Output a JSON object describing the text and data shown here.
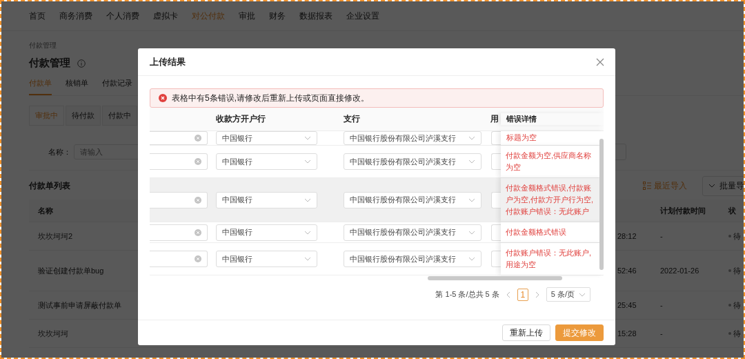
{
  "nav": {
    "items": [
      {
        "label": "首页",
        "selected": false
      },
      {
        "label": "商务消费",
        "selected": false
      },
      {
        "label": "个人消费",
        "selected": false
      },
      {
        "label": "虚拟卡",
        "selected": false
      },
      {
        "label": "对公付款",
        "selected": true
      },
      {
        "label": "审批",
        "selected": false
      },
      {
        "label": "财务",
        "selected": false
      },
      {
        "label": "数据报表",
        "selected": false
      },
      {
        "label": "企业设置",
        "selected": false
      }
    ]
  },
  "breadcrumb": "付款管理",
  "page_title": "付款管理",
  "tabs": [
    {
      "label": "付款单",
      "selected": true
    },
    {
      "label": "核销单",
      "selected": false
    },
    {
      "label": "付款记录",
      "selected": false
    }
  ],
  "status_tabs": [
    {
      "label": "审批中",
      "selected": true
    },
    {
      "label": "待付款",
      "selected": false
    },
    {
      "label": "付款中",
      "selected": false
    }
  ],
  "filter": {
    "label": "名称：",
    "placeholder": "请输入"
  },
  "list": {
    "title": "付款单列表",
    "actions": [
      {
        "label": "最近导入",
        "kind": "link"
      },
      {
        "label": "批量导",
        "kind": "dropdown"
      }
    ],
    "columns": {
      "name": "名称",
      "planned": "计划付款时间",
      "status": "状"
    },
    "rows": [
      {
        "name": "坎坎坷坷2",
        "time": "28:12",
        "planned": "-",
        "status": "待"
      },
      {
        "name": "验证创建付款单bug",
        "time": "52:46",
        "planned": "2022-01-26",
        "status": "待"
      },
      {
        "name": "测试事前申请屏蔽付款单",
        "time": "25:45",
        "planned": "-",
        "status": "待"
      },
      {
        "name": "坎坎坷坷",
        "time": "15:28",
        "planned": "-",
        "status": "待"
      }
    ]
  },
  "modal": {
    "title": "上传结果",
    "alert": "表格中有5条错误,请修改后重新上传或页面直接修改。",
    "table": {
      "columns": [
        "收款方开户行",
        "支行",
        "用"
      ],
      "error_column": "错误详情",
      "rows": [
        {
          "bank": "中国银行",
          "branch": "中国银行股份有限公司泸溪支行",
          "error": "标题为空",
          "highlighted": false
        },
        {
          "bank": "中国银行",
          "branch": "中国银行股份有限公司泸溪支行",
          "error": "付款金额为空,供应商名称为空",
          "highlighted": false
        },
        {
          "bank": "中国银行",
          "branch": "中国银行股份有限公司泸溪支行",
          "error": "付款金额格式错误,付款账户为空,付款方开户行为空,付款账户错误：无此账户",
          "highlighted": true
        },
        {
          "bank": "中国银行",
          "branch": "中国银行股份有限公司泸溪支行",
          "error": "付款金额格式错误",
          "highlighted": false
        },
        {
          "bank": "中国银行",
          "branch": "中国银行股份有限公司泸溪支行",
          "error": "付款账户错误：无此账户,用途为空",
          "highlighted": false
        }
      ]
    },
    "pagination": {
      "summary": "第 1-5 条/总共 5 条",
      "pages": [
        {
          "label": "1",
          "selected": true
        }
      ],
      "page_size": "5 条/页"
    },
    "buttons": [
      {
        "label": "重新上传",
        "kind": "default"
      },
      {
        "label": "提交修改",
        "kind": "primary"
      }
    ]
  }
}
